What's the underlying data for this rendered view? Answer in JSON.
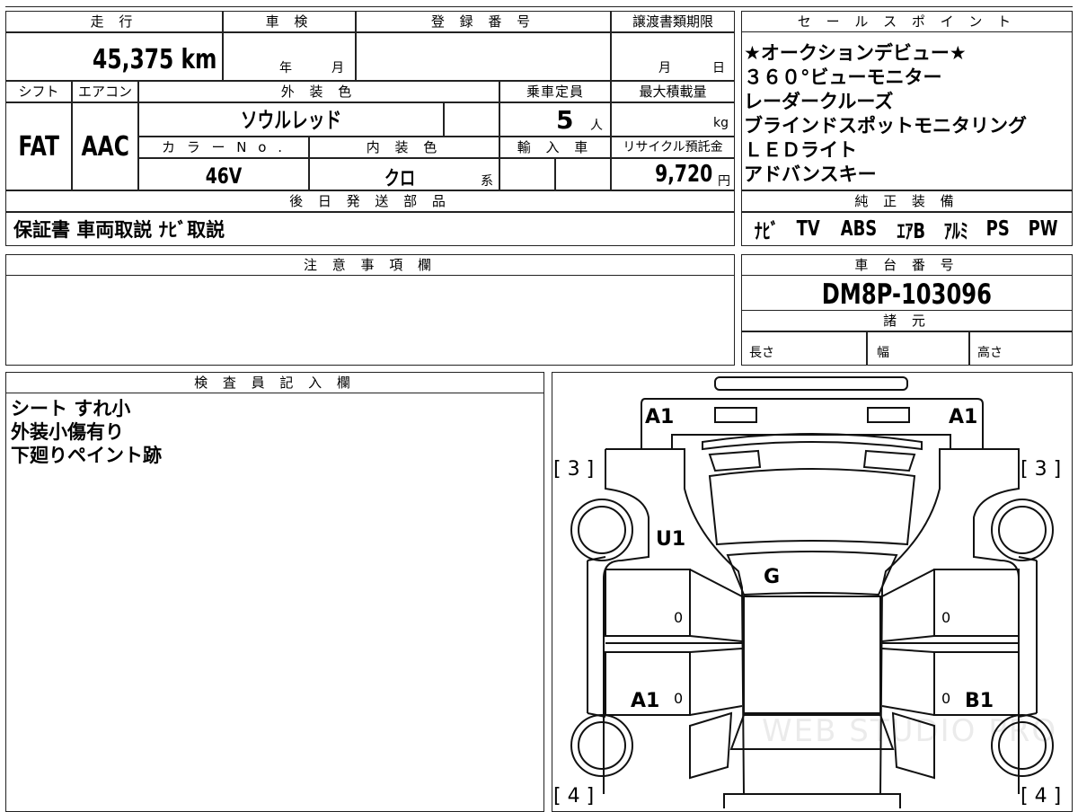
{
  "top": {
    "mileage_header": "走 行",
    "mileage": "45,375 km",
    "inspection_header": "車 検",
    "inspection_year": "年",
    "inspection_month": "月",
    "registration_header": "登 録 番 号",
    "transfer_header": "譲渡書類期限",
    "transfer_month": "月",
    "transfer_day": "日",
    "shift_header": "シフト",
    "shift": "FAT",
    "aircon_header": "エアコン",
    "aircon": "AAC",
    "exterior_color_header": "外 装 色",
    "exterior_color": "ソウルレッド",
    "capacity_header": "乗車定員",
    "capacity": "5",
    "capacity_unit": "人",
    "max_load_header": "最大積載量",
    "max_load_unit": "kg",
    "color_no_header": "カ ラ ー N o .",
    "color_no": "46V",
    "interior_color_header": "内 装 色",
    "interior_color": "クロ",
    "interior_suffix": "系",
    "import_header": "輸 入 車",
    "recycle_header": "リサイクル預託金",
    "recycle_fee": "9,720",
    "recycle_unit": "円",
    "parts_header": "後 日 発 送 部 品",
    "parts": "保証書 車両取説 ﾅﾋﾞ取説"
  },
  "sales_points": {
    "header": "セ ー ル ス ポ イ ン ト",
    "items": [
      "★オークションデビュー★",
      "３６０°ビューモニター",
      "レーダークルーズ",
      "ブラインドスポットモニタリング",
      "ＬＥＤライト",
      "アドバンスキー"
    ]
  },
  "equipment": {
    "header": "純 正 装 備",
    "items": [
      "ﾅﾋﾞ",
      "TV",
      "ABS",
      "ｴｱB",
      "ｱﾙﾐ",
      "PS",
      "PW"
    ]
  },
  "notes": {
    "header": "注 意 事 項 欄",
    "text": ""
  },
  "chassis": {
    "header": "車 台 番 号",
    "number": "DM8P-103096",
    "spec_header": "諸 元",
    "length": "長さ",
    "width": "幅",
    "height": "高さ"
  },
  "inspector": {
    "header": "検 査 員 記 入 欄",
    "lines": [
      "シート すれ小",
      "外装小傷有り",
      "下廻りペイント跡"
    ]
  },
  "diagram": {
    "marks": {
      "front_left": "A1",
      "front_right": "A1",
      "fender_left": "U1",
      "hood": "G",
      "door_left": "A1",
      "door_right": "B1",
      "zero_1": "0",
      "zero_2": "0",
      "zero_3": "0",
      "zero_4": "0",
      "tire_fl": "[ 3 ]",
      "tire_fr": "[ 3 ]",
      "tire_rl": "[ 4 ]",
      "tire_rr": "[ 4 ]"
    },
    "watermark": "WEB STUDIO PRO"
  }
}
